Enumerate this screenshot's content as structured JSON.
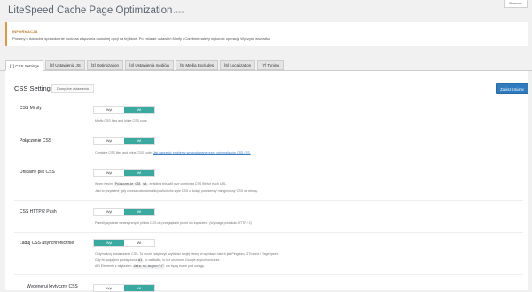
{
  "header": {
    "title": "LiteSpeed Cache Page Optimization",
    "version": "v4.5.2",
    "help_label": "Pomoc"
  },
  "notice": {
    "label": "INFORMACJA",
    "message": "Prosimy o dokładne sprawdzenie podczas włączania dowolnej opcji na tej liście. Po zmianie ustawień Minify / Combine należy wykonać operację Wyczyść wszystko."
  },
  "tabs": [
    {
      "label": "[1] CSS Settings",
      "active": true
    },
    {
      "label": "[2] Ustawienia JS",
      "active": false
    },
    {
      "label": "[3] Optimization",
      "active": false
    },
    {
      "label": "[4] Ustawienia mediów",
      "active": false
    },
    {
      "label": "[5] Media Excludes",
      "active": false
    },
    {
      "label": "[6] Localization",
      "active": false
    },
    {
      "label": "[7] Tuning",
      "active": false
    }
  ],
  "section": {
    "title": "CSS Settings",
    "reset_label": "Domyślne ustawienia",
    "save_label": "Zapisz zmiany"
  },
  "toggle_labels": {
    "off": "Wył",
    "on": "Wł"
  },
  "rows": [
    {
      "label": "CSS Minify",
      "state": "on",
      "desc1": "Minify CSS files and inline CSS code."
    },
    {
      "label": "Połączenie CSS",
      "state": "on",
      "desc1_pre": "Combine CSS files and inline CSS code.",
      "desc1_link": "Jak naprawić problemy spowodowane przez optymalizację CSS / JS."
    },
    {
      "label": "Unikalny plik CSS",
      "state": "on",
      "desc1_pre": "When having",
      "code1": "Połączenie CSS",
      "code2": "Wł",
      "desc1_post": ", enabling this will give combined CSS file for each URL.",
      "desc2": "Jest to przydatne, gdy chcesz uzbrudowelić/poufunkcfić style CSS z dodą / pomisemą/ minąjmowny CSS na stronę."
    },
    {
      "label": "CSS HTTP/2 Push",
      "state": "on",
      "desc1": "Prześlij wysłanie wewnętrznych plików CSS do przeglądarki przed ich żądaniem. (Wymaga protokołu HTTP / 2)"
    },
    {
      "label": "Ładuj CSS asynchronicznie",
      "state": "off",
      "desc1": "Optymalizuj dostarczanie CSS. To może zwiększyć szybkość twojej strony w wynikach takich jak Pingdom, GTmetrix i PageSpeed.",
      "desc2_pre": "Gdy ta opcja jest przełączona",
      "code1": "Wł",
      "desc2_post": ", to zakładkę, to też uruchomi Google asynchronicznie.",
      "desc3_pre": "API Elementy z atrybutem",
      "code2": "data-no-async=\"1\"",
      "desc3_post": "nie będą brane pod uwagę."
    },
    {
      "label": "Wygeneruj krytyczny CSS",
      "state": "on"
    }
  ],
  "colors": {
    "accent": "#3aa9a0",
    "save_button": "#2e7bbf",
    "notice_border": "#e8963c"
  }
}
